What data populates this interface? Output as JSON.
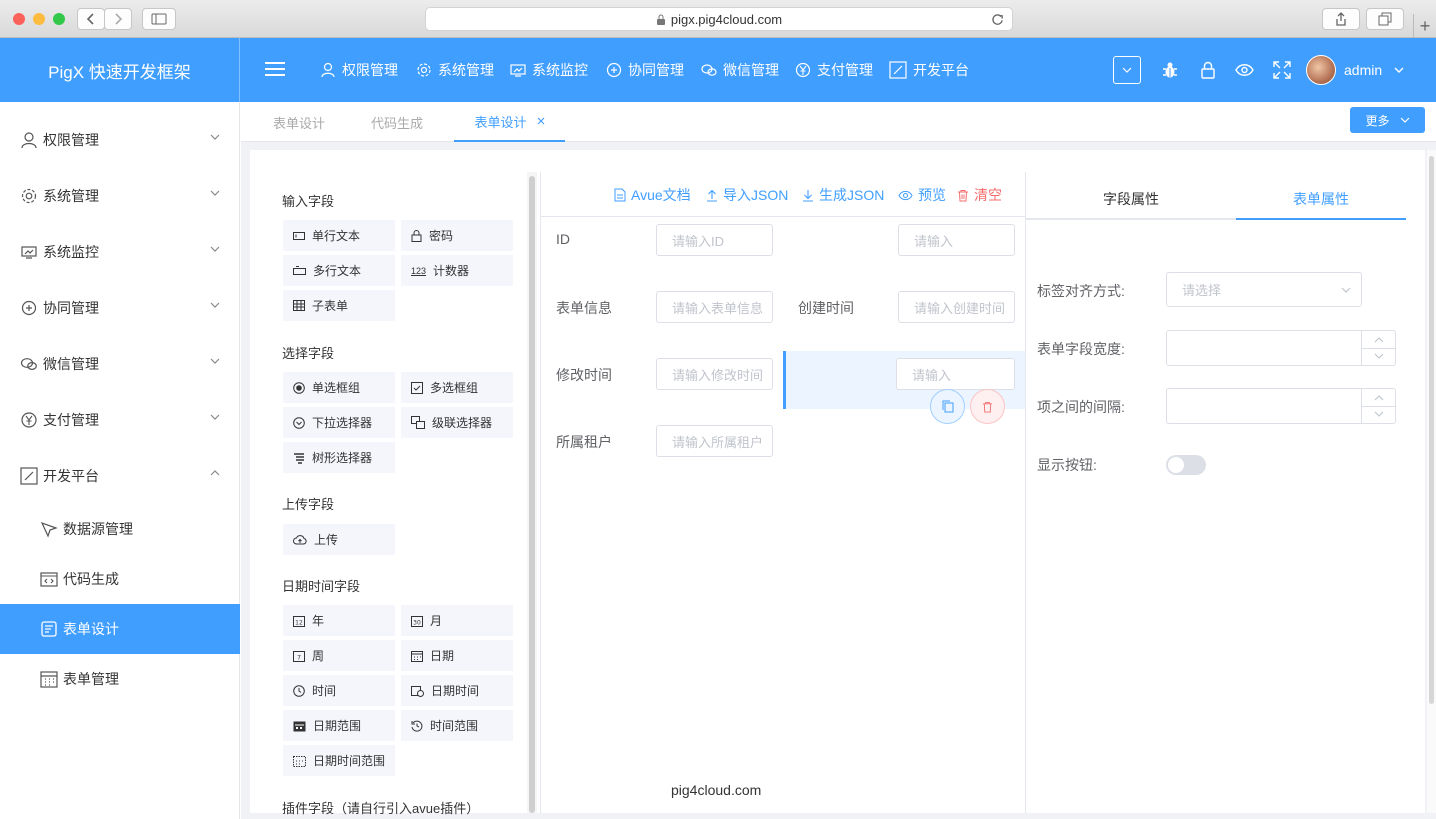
{
  "browser": {
    "url": "pigx.pig4cloud.com"
  },
  "app": {
    "brand": "PigX 快速开发框架",
    "username": "admin"
  },
  "top_menu": [
    "权限管理",
    "系统管理",
    "系统监控",
    "协同管理",
    "微信管理",
    "支付管理",
    "开发平台"
  ],
  "sidebar": {
    "items": [
      {
        "label": "权限管理"
      },
      {
        "label": "系统管理"
      },
      {
        "label": "系统监控"
      },
      {
        "label": "协同管理"
      },
      {
        "label": "微信管理"
      },
      {
        "label": "支付管理"
      },
      {
        "label": "开发平台"
      }
    ],
    "sub_items": [
      {
        "label": "数据源管理"
      },
      {
        "label": "代码生成"
      },
      {
        "label": "表单设计",
        "active": true
      },
      {
        "label": "表单管理"
      }
    ]
  },
  "tabs": [
    {
      "label": "表单设计"
    },
    {
      "label": "代码生成"
    },
    {
      "label": "表单设计",
      "active": true
    }
  ],
  "more_button": "更多",
  "palette": {
    "input_title": "输入字段",
    "input_fields": [
      "单行文本",
      "密码",
      "多行文本",
      "计数器",
      "子表单"
    ],
    "select_title": "选择字段",
    "select_fields": [
      "单选框组",
      "多选框组",
      "下拉选择器",
      "级联选择器",
      "树形选择器"
    ],
    "upload_title": "上传字段",
    "upload_fields": [
      "上传"
    ],
    "datetime_title": "日期时间字段",
    "datetime_fields": [
      "年",
      "月",
      "周",
      "日期",
      "时间",
      "日期时间",
      "日期范围",
      "时间范围",
      "日期时间范围"
    ],
    "plugin_title": "插件字段（请自行引入avue插件）"
  },
  "toolbar": {
    "docs": "Avue文档",
    "import": "导入JSON",
    "generate": "生成JSON",
    "preview": "预览",
    "clear": "清空"
  },
  "form": {
    "id_label": "ID",
    "id_placeholder": "请输入ID",
    "top_right_placeholder": "请输入",
    "info_label": "表单信息",
    "info_placeholder": "请输入表单信息",
    "created_label": "创建时间",
    "created_placeholder": "请输入创建时间",
    "modified_label": "修改时间",
    "modified_placeholder": "请输入修改时间",
    "selected_placeholder": "请输入",
    "tenant_label": "所属租户",
    "tenant_placeholder": "请输入所属租户"
  },
  "watermark": "pig4cloud.com",
  "props": {
    "tab_field": "字段属性",
    "tab_form": "表单属性",
    "align_label": "标签对齐方式:",
    "align_placeholder": "请选择",
    "width_label": "表单字段宽度:",
    "gutter_label": "项之间的间隔:",
    "show_btn_label": "显示按钮:"
  },
  "colors": {
    "primary": "#409eff",
    "danger": "#f56c6c"
  }
}
